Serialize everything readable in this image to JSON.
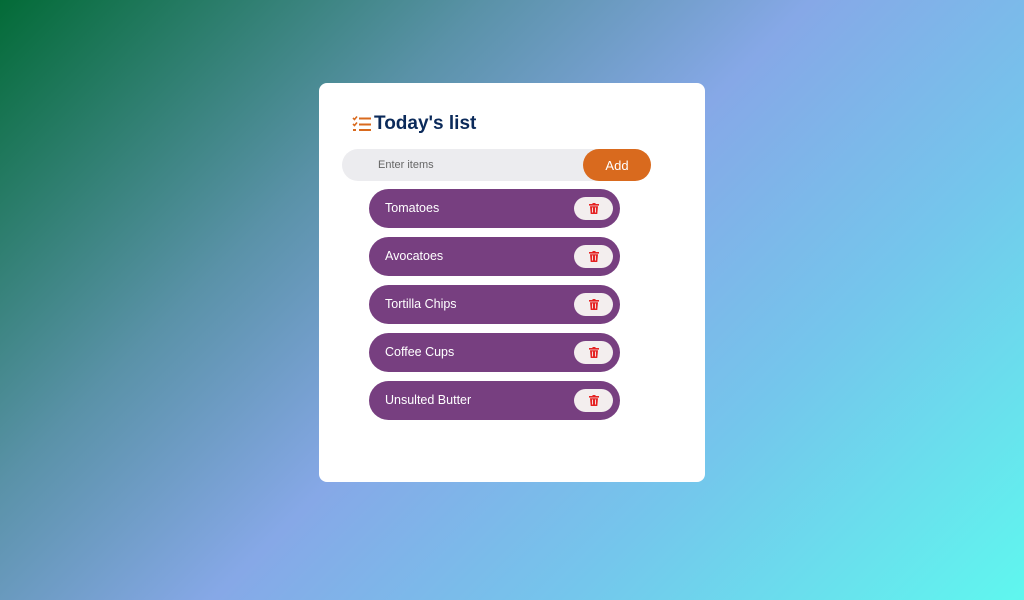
{
  "header": {
    "title": "Today's list",
    "icon": "checklist-icon",
    "icon_color": "#d96a1e"
  },
  "input": {
    "placeholder": "Enter items",
    "value": ""
  },
  "add_button": {
    "label": "Add",
    "color": "#d96a1e"
  },
  "items": [
    {
      "label": "Tomatoes"
    },
    {
      "label": "Avocatoes"
    },
    {
      "label": "Tortilla Chips"
    },
    {
      "label": "Coffee Cups"
    },
    {
      "label": "Unsulted Butter"
    }
  ],
  "colors": {
    "item_bg": "#773f80",
    "delete_icon": "#e52222",
    "title": "#0b2a5a"
  },
  "delete_icon": "trash-icon"
}
